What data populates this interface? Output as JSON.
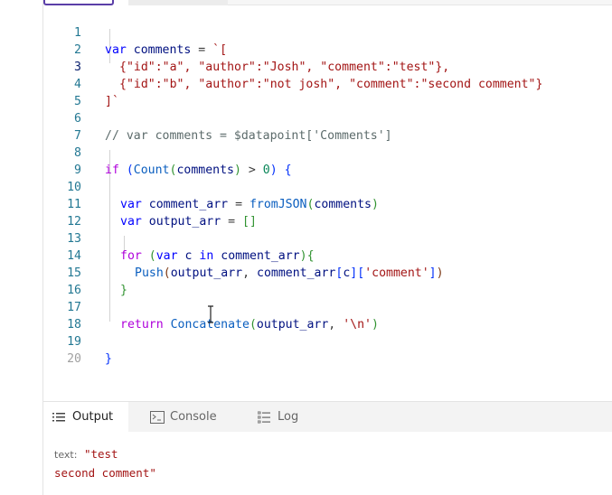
{
  "editor": {
    "line_numbers": [
      "1",
      "2",
      "3",
      "4",
      "5",
      "6",
      "7",
      "8",
      "9",
      "10",
      "11",
      "12",
      "13",
      "14",
      "15",
      "16",
      "17",
      "18",
      "19",
      "20"
    ],
    "lines": {
      "l1": [
        "var",
        "comments",
        "=",
        "`["
      ],
      "l2": [
        "{\"id\":\"a\", \"author\":\"Josh\", \"comment\":\"test\"},"
      ],
      "l3": [
        "{\"id\":\"b\", \"author\":\"not josh\", \"comment\":\"second comment\"}"
      ],
      "l4": [
        "]`"
      ],
      "l6": [
        "// var comments = $datapoint['Comments']"
      ],
      "l8": [
        "if",
        "(",
        "Count",
        "(",
        "comments",
        ")",
        ">",
        "0",
        ")",
        "{"
      ],
      "l10": [
        "var",
        "comment_arr",
        "=",
        "fromJSON",
        "(",
        "comments",
        ")"
      ],
      "l11": [
        "var",
        "output_arr",
        "=",
        "[]"
      ],
      "l13": [
        "for",
        "(",
        "var",
        "c",
        "in",
        "comment_arr",
        ")",
        "{"
      ],
      "l14": [
        "Push",
        "(",
        "output_arr",
        ",",
        "comment_arr",
        "[",
        "c",
        "]",
        "[",
        "'comment'",
        "]",
        ")"
      ],
      "l15": [
        "}"
      ],
      "l17": [
        "return",
        "Concatenate",
        "(",
        "output_arr",
        ",",
        "'\\n'",
        ")"
      ],
      "l19": [
        "}"
      ]
    }
  },
  "panel": {
    "tabs": [
      {
        "label": "Output",
        "icon": "list-icon"
      },
      {
        "label": "Console",
        "icon": "console-icon"
      },
      {
        "label": "Log",
        "icon": "log-list-icon"
      }
    ],
    "result_label": "text:",
    "result_line1": "\"test",
    "result_line2": "second comment\""
  },
  "colors": {
    "accent": "#5b3fa8",
    "keyword": "#0000ff",
    "string": "#a31515",
    "line_number": "#237893"
  }
}
